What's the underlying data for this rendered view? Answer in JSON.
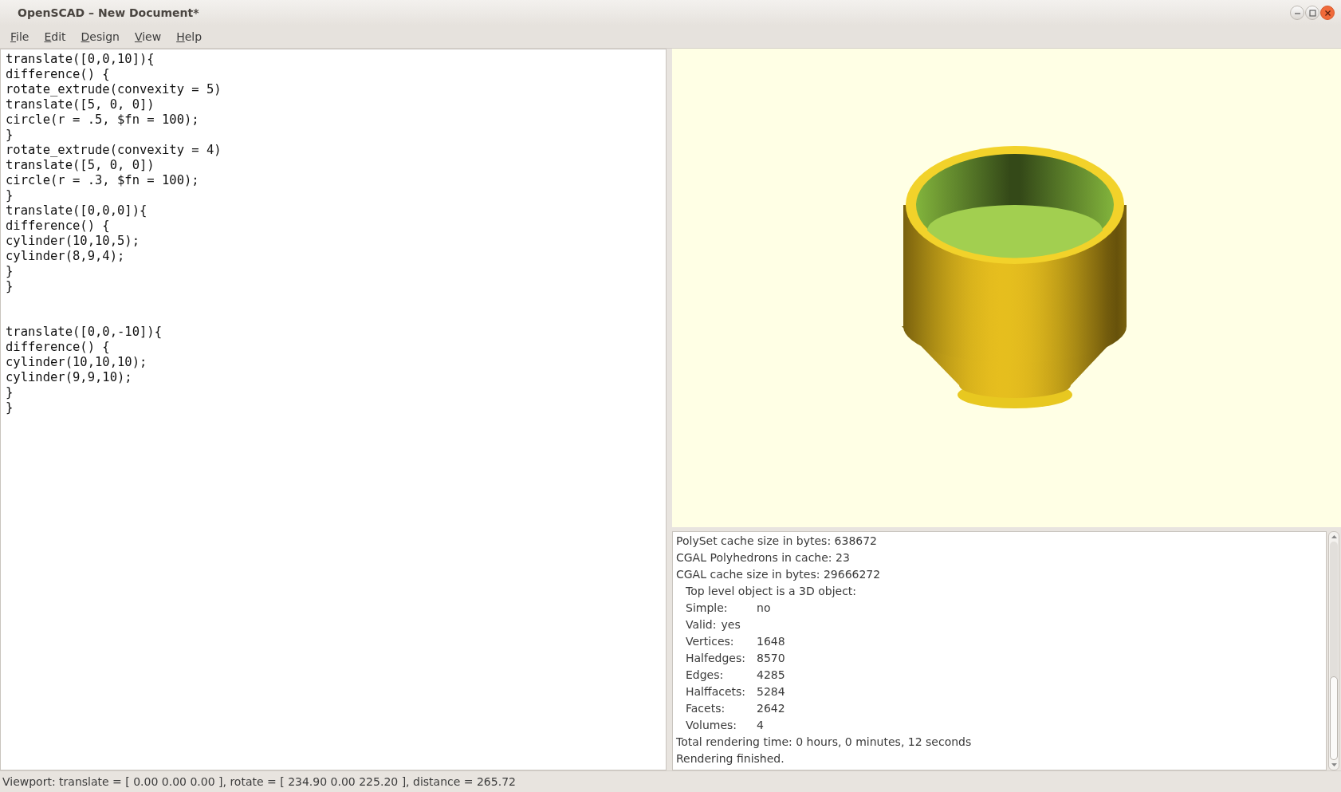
{
  "window": {
    "title": "OpenSCAD – New Document*"
  },
  "menu": [
    {
      "label": "File",
      "underlined": true
    },
    {
      "label": "Edit",
      "underlined": true
    },
    {
      "label": "Design",
      "underlined": true
    },
    {
      "label": "View",
      "underlined": true
    },
    {
      "label": "Help",
      "underlined": true
    }
  ],
  "editor": {
    "code": "translate([0,0,10]){\ndifference() {\nrotate_extrude(convexity = 5)\ntranslate([5, 0, 0])\ncircle(r = .5, $fn = 100);\n}\nrotate_extrude(convexity = 4)\ntranslate([5, 0, 0])\ncircle(r = .3, $fn = 100);\n}\ntranslate([0,0,0]){\ndifference() {\ncylinder(10,10,5);\ncylinder(8,9,4);\n}\n}\n\n\ntranslate([0,0,-10]){\ndifference() {\ncylinder(10,10,10);\ncylinder(9,9,10);\n}\n}"
  },
  "console": [
    {
      "kind": "plain",
      "text": "PolySet cache size in bytes: 638672"
    },
    {
      "kind": "plain",
      "text": "CGAL Polyhedrons in cache: 23"
    },
    {
      "kind": "plain",
      "text": "CGAL cache size in bytes: 29666272"
    },
    {
      "kind": "indent",
      "text": "Top level object is a 3D object:"
    },
    {
      "kind": "stat",
      "label": "Simple:",
      "value": "no"
    },
    {
      "kind": "stat",
      "label": "Valid:",
      "value": "yes"
    },
    {
      "kind": "stat",
      "label": "Vertices:",
      "value": "1648"
    },
    {
      "kind": "stat",
      "label": "Halfedges:",
      "value": "8570"
    },
    {
      "kind": "stat",
      "label": "Edges:",
      "value": "4285"
    },
    {
      "kind": "stat",
      "label": "Halffacets:",
      "value": "5284"
    },
    {
      "kind": "stat",
      "label": "Facets:",
      "value": "2642"
    },
    {
      "kind": "stat",
      "label": "Volumes:",
      "value": "4"
    },
    {
      "kind": "plain",
      "text": "Total rendering time: 0 hours, 0 minutes, 12 seconds"
    },
    {
      "kind": "plain",
      "text": "Rendering finished."
    }
  ],
  "status_bar": "Viewport: translate = [ 0.00 0.00 0.00 ], rotate = [ 234.90 0.00 225.20 ], distance = 265.72"
}
